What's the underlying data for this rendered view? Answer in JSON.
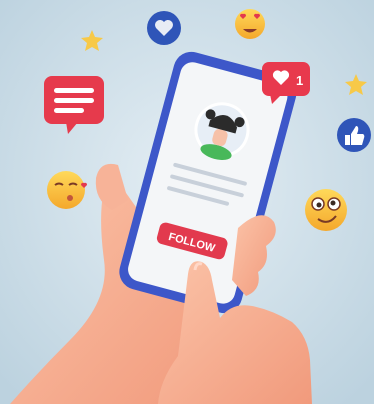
{
  "illustration": {
    "follow_button_label": "FOLLOW",
    "like_badge_count": "1",
    "icons": [
      "heart-icon",
      "love-eyes-emoji-icon",
      "star-icon",
      "message-bubble-icon",
      "like-notification-icon",
      "thumbs-up-icon",
      "kiss-emoji-icon",
      "dizzy-emoji-icon",
      "profile-avatar-icon"
    ],
    "colors": {
      "background": "#cfe0ea",
      "phone_frame": "#3d57c9",
      "screen": "#f4f6f8",
      "follow_button": "#e23a4e",
      "badge_red": "#e8394d",
      "skin": "#f6a98b",
      "star_yellow": "#f7c948"
    }
  }
}
